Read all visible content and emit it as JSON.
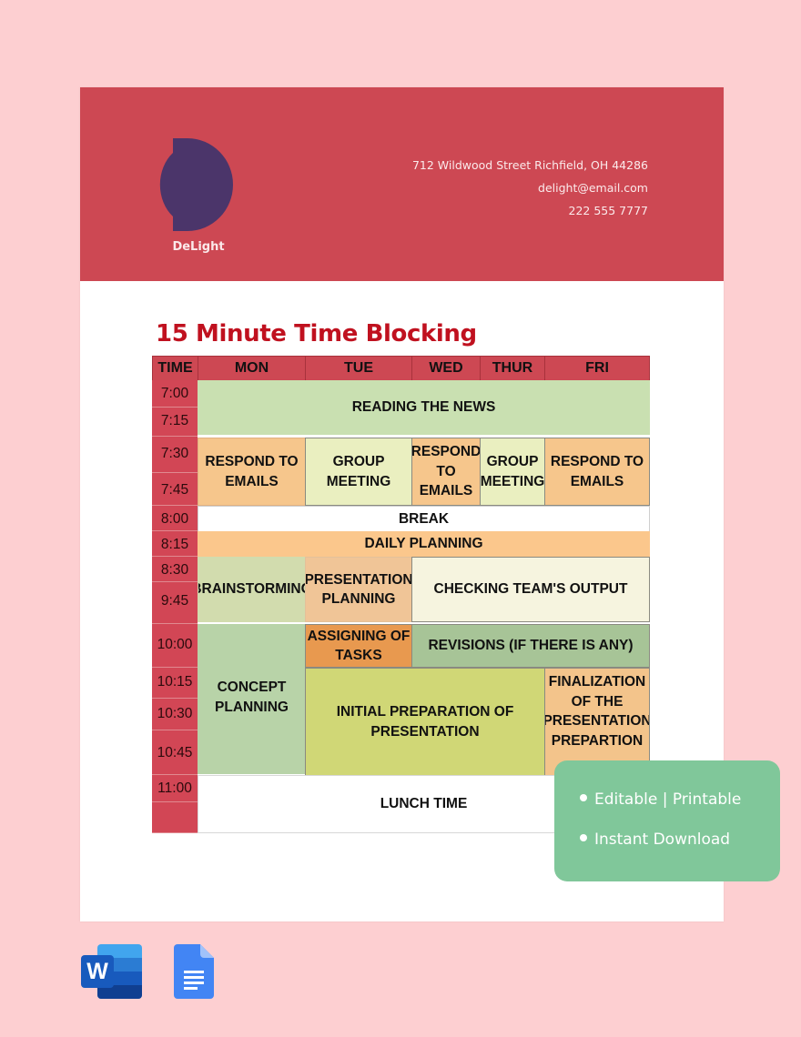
{
  "company": {
    "name": "DeLight",
    "address": "712 Wildwood Street Richfield, OH 44286",
    "email": "delight@email.com",
    "phone": "222 555 7777",
    "logo_icon": "half-circle-d-logo"
  },
  "document": {
    "title": "15 Minute Time Blocking"
  },
  "schedule": {
    "headers": [
      "TIME",
      "MON",
      "TUE",
      "WED",
      "THUR",
      "FRI"
    ],
    "times": [
      "7:00",
      "7:15",
      "7:30",
      "7:45",
      "8:00",
      "8:15",
      "8:30",
      "9:45",
      "10:00",
      "10:15",
      "10:30",
      "10:45",
      "11:00",
      ""
    ],
    "events": [
      {
        "label": "READING THE NEWS",
        "days": "MON-FRI",
        "slots": "7:00-7:15",
        "color": "#c9e0b1"
      },
      {
        "label": "RESPOND TO EMAILS",
        "days": "MON",
        "slots": "7:30-7:45",
        "color": "#f6c68c"
      },
      {
        "label": "GROUP MEETING",
        "days": "TUE",
        "slots": "7:30-7:45",
        "color": "#eaefc0"
      },
      {
        "label": "RESPOND TO EMAILS",
        "days": "WED",
        "slots": "7:30-7:45",
        "color": "#f6c68c"
      },
      {
        "label": "GROUP MEETING",
        "days": "THUR",
        "slots": "7:30-7:45",
        "color": "#eaefc0"
      },
      {
        "label": "RESPOND TO EMAILS",
        "days": "FRI",
        "slots": "7:30-7:45",
        "color": "#f6c68c"
      },
      {
        "label": "BREAK",
        "days": "MON-FRI",
        "slots": "8:00",
        "color": "#ffffff"
      },
      {
        "label": "DAILY PLANNING",
        "days": "MON-FRI",
        "slots": "8:15",
        "color": "#fbc78c"
      },
      {
        "label": "BRAINSTORMING",
        "days": "MON",
        "slots": "8:30-9:45",
        "color": "#d2dcae"
      },
      {
        "label": "PRESENTATION PLANNING",
        "days": "TUE",
        "slots": "8:30-9:45",
        "color": "#f0c597"
      },
      {
        "label": "CHECKING TEAM'S OUTPUT",
        "days": "WED-FRI",
        "slots": "8:30-9:45",
        "color": "#f6f4df"
      },
      {
        "label": "CONCEPT PLANNING",
        "days": "MON",
        "slots": "10:00-10:45",
        "color": "#b8d3a8"
      },
      {
        "label": "ASSIGNING OF TASKS",
        "days": "TUE",
        "slots": "10:00",
        "color": "#e8994f"
      },
      {
        "label": "REVISIONS (IF THERE IS ANY)",
        "days": "WED-FRI",
        "slots": "10:00",
        "color": "#a7c497"
      },
      {
        "label": "INITIAL PREPARATION OF PRESENTATION",
        "days": "TUE-THUR",
        "slots": "10:15-10:45",
        "color": "#d0d776"
      },
      {
        "label": "FINALIZATION OF THE PRESENTATION PREPARTION",
        "days": "FRI",
        "slots": "10:15-10:45",
        "color": "#f3c48b"
      },
      {
        "label": "LUNCH TIME",
        "days": "MON-FRI",
        "slots": "11:00",
        "color": "#ffffff"
      }
    ]
  },
  "badge": {
    "items": [
      "Editable | Printable",
      "Instant Download"
    ]
  },
  "formats": [
    {
      "name": "Microsoft Word",
      "icon": "word-icon"
    },
    {
      "name": "Google Docs",
      "icon": "google-docs-icon"
    }
  ],
  "colors": {
    "background": "#fdcfd1",
    "header": "#cd4853",
    "title": "#c0111f",
    "logo": "#4b356a",
    "badge": "#80c79a"
  }
}
